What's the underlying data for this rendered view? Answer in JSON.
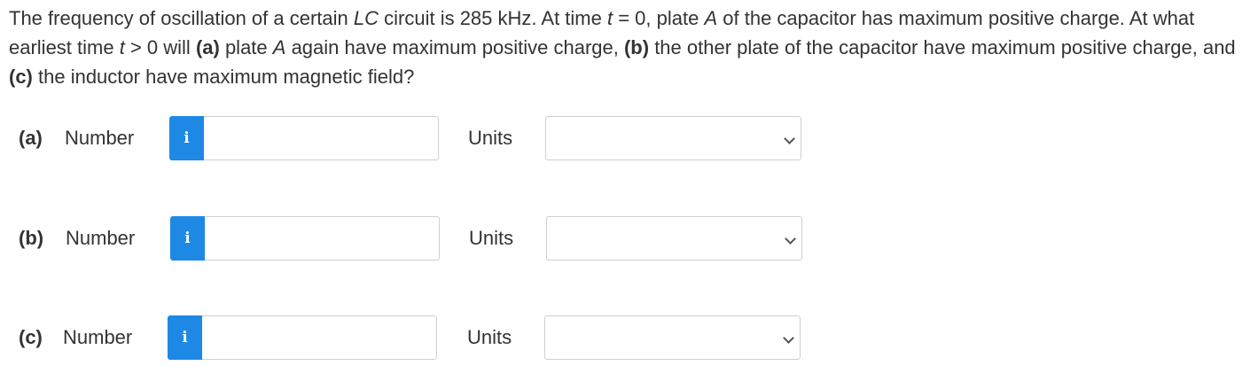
{
  "question": {
    "parts": [
      "The frequency of oscillation of a certain ",
      "LC",
      " circuit is 285 kHz. At time ",
      "t",
      " = 0, plate ",
      "A",
      " of the capacitor has maximum positive charge. At what earliest time ",
      "t",
      " > 0 will ",
      "(a)",
      " plate ",
      "A",
      " again have maximum positive charge, ",
      "(b)",
      " the other plate of the capacitor have maximum positive charge, and ",
      "(c)",
      " the inductor have maximum magnetic field?"
    ]
  },
  "rows": [
    {
      "part": "(a)",
      "number_label": "Number",
      "info_icon": "i",
      "value": "",
      "units_label": "Units",
      "units_value": ""
    },
    {
      "part": "(b)",
      "number_label": "Number",
      "info_icon": "i",
      "value": "",
      "units_label": "Units",
      "units_value": ""
    },
    {
      "part": "(c)",
      "number_label": "Number",
      "info_icon": "i",
      "value": "",
      "units_label": "Units",
      "units_value": ""
    }
  ],
  "colors": {
    "info_button": "#1e88e5",
    "text": "#333333",
    "border": "#cfcfcf"
  }
}
